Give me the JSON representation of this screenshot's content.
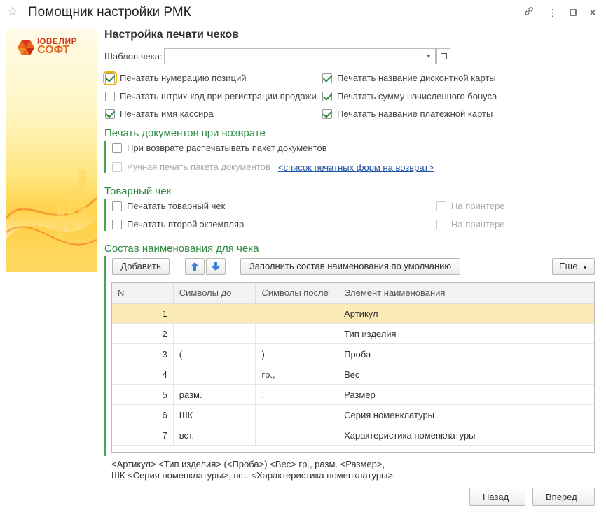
{
  "window": {
    "title": "Помощник настройки РМК",
    "star_icon": "star-icon",
    "link_icon": "link-icon",
    "menu_icon": "more-vertical-icon",
    "maximize_icon": "maximize-icon",
    "close_icon": "close-icon"
  },
  "logo": {
    "line1": "ЮВЕЛИР",
    "line2": "СОФТ"
  },
  "print_settings": {
    "heading": "Настройка печати чеков",
    "template_label": "Шаблон чека:",
    "template_value": "",
    "checkboxes_left": [
      {
        "label": "Печатать нумерацию позиций",
        "checked": true
      },
      {
        "label": "Печатать штрих-код при регистрации продажи",
        "checked": false
      },
      {
        "label": "Печатать имя кассира",
        "checked": true
      }
    ],
    "checkboxes_right": [
      {
        "label": "Печатать название дисконтной карты",
        "checked": true
      },
      {
        "label": "Печатать сумму начисленного бонуса",
        "checked": true
      },
      {
        "label": "Печатать название платежной карты",
        "checked": true
      }
    ]
  },
  "return_docs": {
    "title": "Печать документов при возврате",
    "print_package_label": "При возврате распечатывать пакет документов",
    "manual_print_label": "Ручная печать пакета документов",
    "forms_link": "<список печатных форм на возврат>"
  },
  "sales_receipt": {
    "title": "Товарный чек",
    "print_receipt_label": "Печатать товарный чек",
    "print_copy_label": "Печатать второй экземпляр",
    "printer_label_1": "На принтере",
    "printer_label_2": "На принтере"
  },
  "name_composition": {
    "title": "Состав наименования для чека",
    "add_button": "Добавить",
    "fill_default_button": "Заполнить состав наименования по умолчанию",
    "more_button": "Еще",
    "columns": [
      "N",
      "Символы до",
      "Символы после",
      "Элемент наименования"
    ],
    "rows": [
      {
        "n": "1",
        "before": "",
        "after": "",
        "element": "Артикул"
      },
      {
        "n": "2",
        "before": "",
        "after": "",
        "element": "Тип изделия"
      },
      {
        "n": "3",
        "before": "(",
        "after": ")",
        "element": "Проба"
      },
      {
        "n": "4",
        "before": "",
        "after": " гр.,",
        "element": "Вес"
      },
      {
        "n": "5",
        "before": "разм.",
        "after": ",",
        "element": "Размер"
      },
      {
        "n": "6",
        "before": "ШК",
        "after": ",",
        "element": "Серия номенклатуры"
      },
      {
        "n": "7",
        "before": "вст.",
        "after": "",
        "element": "Характеристика номенклатуры"
      }
    ],
    "preview_line1": "<Артикул> <Тип изделия> (<Проба>) <Вес> гр., разм. <Размер>,",
    "preview_line2": "ШК <Серия номенклатуры>, вст. <Характеристика номенклатуры>"
  },
  "footer": {
    "back_button": "Назад",
    "forward_button": "Вперед"
  }
}
